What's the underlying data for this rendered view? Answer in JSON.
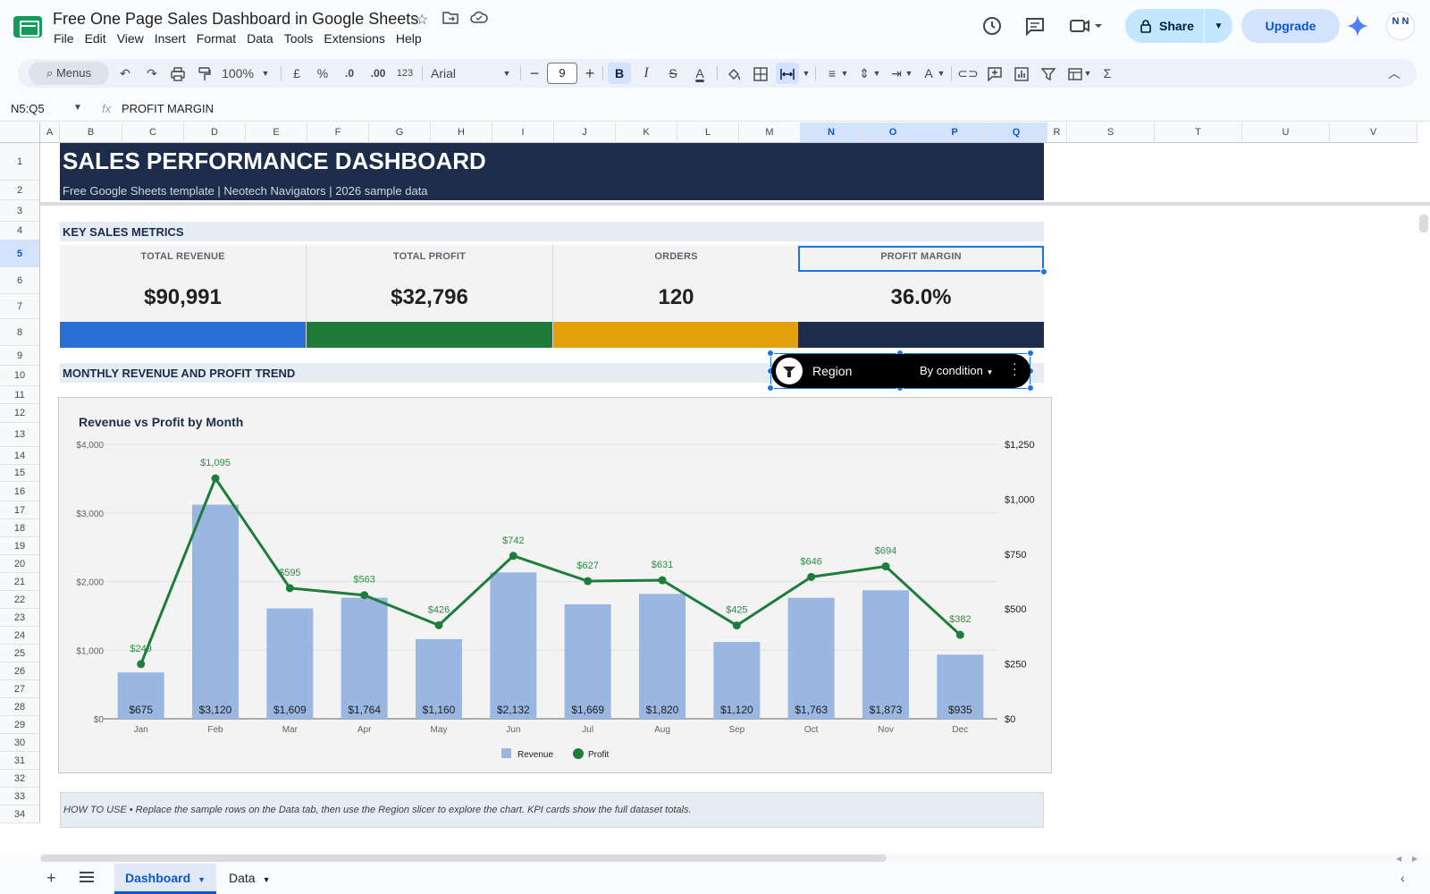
{
  "app": {
    "title": "Free One Page Sales Dashboard in Google Sheets",
    "menus": [
      "File",
      "Edit",
      "View",
      "Insert",
      "Format",
      "Data",
      "Tools",
      "Extensions",
      "Help"
    ],
    "share_label": "Share",
    "upgrade_label": "Upgrade",
    "avatar_text": "N N"
  },
  "toolbar": {
    "search_label": "Menus",
    "zoom": "100%",
    "currency": "£",
    "percent": "%",
    "dec_less": ".0",
    "dec_more": ".00",
    "number_format": "123",
    "font": "Arial",
    "font_size": "9"
  },
  "formula_bar": {
    "name_box": "N5:Q5",
    "fx": "fx",
    "content": "PROFIT MARGIN"
  },
  "grid": {
    "columns": [
      "A",
      "B",
      "C",
      "D",
      "E",
      "F",
      "G",
      "H",
      "I",
      "J",
      "K",
      "L",
      "M",
      "N",
      "O",
      "P",
      "Q",
      "R",
      "S",
      "T",
      "U",
      "V"
    ],
    "selected_columns": [
      "N",
      "O",
      "P",
      "Q"
    ],
    "rows": [
      "1",
      "2",
      "3",
      "4",
      "5",
      "6",
      "7",
      "8",
      "9",
      "10",
      "11",
      "12",
      "13",
      "14",
      "15",
      "16",
      "17",
      "18",
      "19",
      "20",
      "21",
      "22",
      "23",
      "24",
      "25",
      "26",
      "27",
      "28",
      "29",
      "30",
      "31",
      "32",
      "33",
      "34"
    ],
    "selected_row": "5"
  },
  "dashboard": {
    "title": "SALES PERFORMANCE DASHBOARD",
    "subtitle": "Free Google Sheets template  |  Neotech Navigators  |  2026 sample data",
    "metrics_header": "KEY SALES METRICS",
    "kpis": [
      {
        "label": "TOTAL REVENUE",
        "value": "$90,991",
        "color": "#2a6fd6"
      },
      {
        "label": "TOTAL PROFIT",
        "value": "$32,796",
        "color": "#1f7a3a"
      },
      {
        "label": "ORDERS",
        "value": "120",
        "color": "#e3a00d"
      },
      {
        "label": "PROFIT MARGIN",
        "value": "36.0%",
        "color": "#1b2d4b"
      }
    ],
    "trend_header": "MONTHLY REVENUE AND PROFIT TREND",
    "howto": "HOW TO USE  •  Replace the sample rows on the Data tab, then use the Region slicer to explore the chart. KPI cards show the full dataset totals."
  },
  "slicer": {
    "column": "Region",
    "condition": "By condition"
  },
  "chart_data": {
    "type": "bar",
    "title": "Revenue vs Profit by Month",
    "categories": [
      "Jan",
      "Feb",
      "Mar",
      "Apr",
      "May",
      "Jun",
      "Jul",
      "Aug",
      "Sep",
      "Oct",
      "Nov",
      "Dec"
    ],
    "series": [
      {
        "name": "Revenue",
        "type": "bar",
        "axis": "left",
        "color": "#9ab7e2",
        "values": [
          675,
          3120,
          1609,
          1764,
          1160,
          2132,
          1669,
          1820,
          1120,
          1763,
          1873,
          935
        ],
        "labels": [
          "$675",
          "$3,120",
          "$1,609",
          "$1,764",
          "$1,160",
          "$2,132",
          "$1,669",
          "$1,820",
          "$1,120",
          "$1,763",
          "$1,873",
          "$935"
        ]
      },
      {
        "name": "Profit",
        "type": "line",
        "axis": "right",
        "color": "#1e7d3a",
        "values": [
          249,
          1095,
          595,
          563,
          426,
          742,
          627,
          631,
          425,
          646,
          694,
          382
        ],
        "labels": [
          "$249",
          "$1,095",
          "$595",
          "$563",
          "$426",
          "$742",
          "$627",
          "$631",
          "$425",
          "$646",
          "$694",
          "$382"
        ]
      }
    ],
    "left_axis": {
      "ylim": [
        0,
        4000
      ],
      "ticks": [
        "$0",
        "$1,000",
        "$2,000",
        "$3,000",
        "$4,000"
      ]
    },
    "right_axis": {
      "ylim": [
        0,
        1250
      ],
      "ticks": [
        "$0",
        "$250",
        "$500",
        "$750",
        "$1,000",
        "$1,250"
      ]
    },
    "grid": true,
    "legend": "bottom"
  },
  "sheets": [
    {
      "name": "Dashboard",
      "active": true
    },
    {
      "name": "Data",
      "active": false
    }
  ]
}
